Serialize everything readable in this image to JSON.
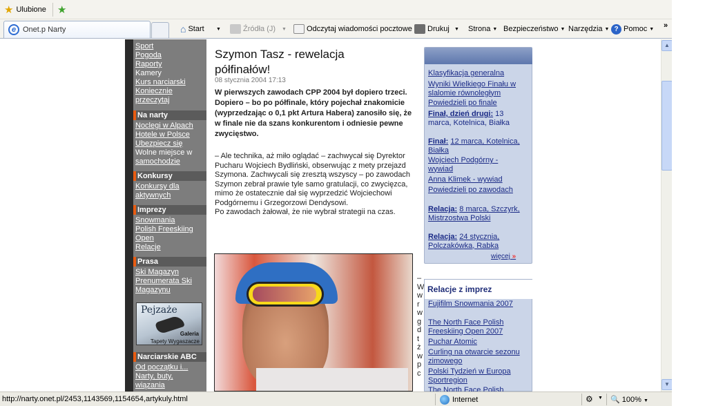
{
  "browser": {
    "favorites_label": "Ulubione",
    "tab_title": "Onet.p Narty",
    "toolbar": {
      "home": "Start",
      "feeds": "Źródła (J)",
      "mail": "Odczytaj wiadomości pocztowe",
      "print": "Drukuj",
      "page": "Strona",
      "safety": "Bezpieczeństwo",
      "tools": "Narzędzia",
      "help": "Pomoc",
      "overflow": "»"
    },
    "status": {
      "url": "http://narty.onet.pl/2453,1143569,1154654,artykuly.html",
      "zone": "Internet",
      "zoom": "100%"
    }
  },
  "left_nav": {
    "top_links": [
      "Sport",
      "Pogoda",
      "Raporty"
    ],
    "plain_item": "Kamery",
    "more_links": [
      "Kurs narciarski",
      "Koniecznie",
      "przeczytaj"
    ],
    "sections": [
      {
        "title": "Na narty",
        "items": [
          "Noclegi w Alpach",
          "Hotele w Polsce",
          "Ubezpiecz się",
          "Wolne miejsce w",
          "samochodzie"
        ]
      },
      {
        "title": "Konkursy",
        "items": [
          "Konkursy dla",
          "aktywnych"
        ]
      },
      {
        "title": "Imprezy",
        "items": [
          "Snowmania",
          "Polish Freeskiing",
          "Open",
          "Relacje"
        ]
      },
      {
        "title": "Prasa",
        "items": [
          "Ski Magazyn",
          "Prenumerata Ski",
          "Magazynu"
        ]
      },
      {
        "title": "Narciarskie ABC",
        "items": [
          "Od początku i...",
          "Narty, buty,",
          "wiązania"
        ]
      }
    ],
    "promo": {
      "title": "Pejzaże",
      "line1": "Galeria",
      "line2": "Tapety Wygaszacze"
    }
  },
  "article": {
    "title": "Szymon Tasz - rewelacja półfinałów!",
    "date": "08 stycznia 2004 17:13",
    "lead": "W pierwszych zawodach CPP 2004 był dopiero trzeci. Dopiero – bo po półfinale, który pojechał znakomicie (wyprzedzając o 0,1 pkt Artura Habera) zanosiło się, że w finale nie da szans konkurentom i odniesie pewne zwycięstwo.",
    "paragraphs": [
      "– Ale technika, aż miło oglądać – zachwycał się Dyrektor Pucharu Wojciech Bydliński, obserwując z mety przejazd Szymona. Zachwycali się zresztą wszyscy – po zawodach Szymon zebrał prawie tyle samo gratulacji, co zwycięzca, mimo że ostatecznie dał się wyprzedzić Wojciechowi Podgórnemu i Grzegorzowi Dendysowi.",
      "Po zawodach żałował, że nie wybrał strategii na czas."
    ],
    "truncated_column": "– W w r w g d t ż w p c"
  },
  "right_box1": {
    "items": [
      {
        "bold": "",
        "text": "Klasyfikacja generalna",
        "plain": ""
      },
      {
        "bold": "",
        "text": "Wyniki Wielkiego Finału w slalomie równoległym",
        "plain": ""
      },
      {
        "bold": "",
        "text": "Powiedzieli po finale",
        "plain": ""
      },
      {
        "bold": "Finał, dzień drugi:",
        "text": "",
        "plain": "13 marca, Kotelnica, Białka"
      },
      {
        "bold": "Finał:",
        "text": "12 marca, Kotelnica, Białka",
        "plain": ""
      },
      {
        "bold": "",
        "text": "Wojciech Podgórny - wywiad",
        "plain": ""
      },
      {
        "bold": "",
        "text": "Anna Klimek - wywiad",
        "plain": ""
      },
      {
        "bold": "",
        "text": "Powiedzieli po zawodach",
        "plain": ""
      },
      {
        "bold": "Relacja:",
        "text": "8 marca, Szczyrk, Mistrzostwa Polski",
        "plain": ""
      },
      {
        "bold": "Relacja:",
        "text": "24 stycznia, Polczakówka, Rabka",
        "plain": ""
      }
    ],
    "more": "więcej"
  },
  "right_box2": {
    "title": "Relacje z imprez",
    "items": [
      "Fujifilm Snowmania 2007",
      "The North Face Polish Freeskiing Open 2007",
      "Puchar Atomic",
      "Curling na otwarcie sezonu zimowego",
      "Polski Tydzień w Europa Sportregion",
      "The North Face Polish"
    ]
  },
  "colors": {
    "accent": "#e85b11",
    "nav_bg": "#7d7d7d",
    "link_blue": "#1a2a86",
    "box_bg": "#cbd5e8"
  }
}
